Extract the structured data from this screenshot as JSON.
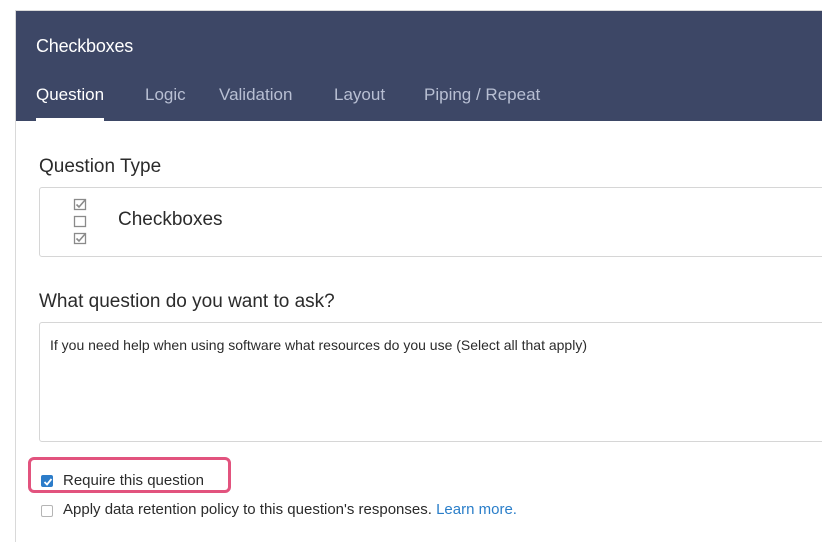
{
  "panel": {
    "title": "Checkboxes",
    "tabs": [
      {
        "label": "Question",
        "active": true
      },
      {
        "label": "Logic",
        "active": false
      },
      {
        "label": "Validation",
        "active": false
      },
      {
        "label": "Layout",
        "active": false
      },
      {
        "label": "Piping / Repeat",
        "active": false
      }
    ]
  },
  "question_type": {
    "label": "Question Type",
    "value": "Checkboxes",
    "icon": "checkbox-list-icon"
  },
  "question": {
    "label": "What question do you want to ask?",
    "value": "If you need help when using software what resources do you use (Select all that apply)"
  },
  "options": {
    "require": {
      "label": "Require this question",
      "checked": true
    },
    "retention": {
      "label": "Apply data retention policy to this question's responses.",
      "link": "Learn more.",
      "checked": false
    }
  },
  "colors": {
    "header": "#3d4766",
    "accent": "#2c7cc9",
    "highlight": "#e2537e"
  }
}
